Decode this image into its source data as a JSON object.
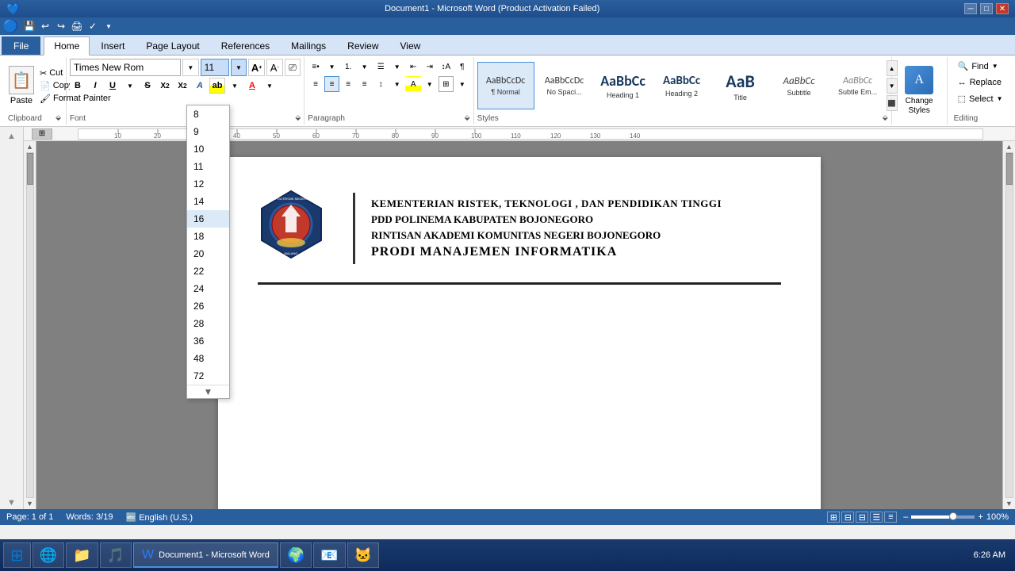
{
  "titleBar": {
    "text": "Document1 - Microsoft Word (Product Activation Failed)",
    "minimize": "─",
    "maximize": "□",
    "close": "✕"
  },
  "quickAccess": {
    "buttons": [
      "💾",
      "↩",
      "↪",
      "⬛",
      "✓"
    ]
  },
  "ribbonTabs": {
    "tabs": [
      "File",
      "Home",
      "Insert",
      "Page Layout",
      "References",
      "Mailings",
      "Review",
      "View"
    ]
  },
  "clipboard": {
    "paste": "Paste",
    "cut": "Cut",
    "copy": "Copy",
    "formatPainter": "Format Painter",
    "label": "Clipboard"
  },
  "font": {
    "name": "Times New Rom",
    "size": "11",
    "label": "Font"
  },
  "paragraph": {
    "label": "Paragraph"
  },
  "styles": {
    "items": [
      {
        "name": "Normal",
        "preview": "AaBbCcDc",
        "class": "normal-style-preview"
      },
      {
        "name": "No Spaci...",
        "preview": "AaBbCcDc",
        "class": "no-space-preview"
      },
      {
        "name": "Heading 1",
        "preview": "AaBbCc",
        "class": "h1-preview"
      },
      {
        "name": "Heading 2",
        "preview": "AaBbCc",
        "class": "h2-preview"
      },
      {
        "name": "Title",
        "preview": "AaB",
        "class": "title-preview"
      },
      {
        "name": "Subtitle",
        "preview": "AaBbCc",
        "class": "subtitle-preview"
      },
      {
        "name": "Subtle Em...",
        "preview": "AaBbCc",
        "class": "subtle-em-preview"
      }
    ],
    "label": "Styles"
  },
  "changeStyles": {
    "label": "Change\nStyles"
  },
  "editing": {
    "find": "Find",
    "replace": "Replace",
    "select": "Select",
    "label": "Editing"
  },
  "fontSizeDropdown": {
    "sizes": [
      "8",
      "9",
      "10",
      "11",
      "12",
      "14",
      "16",
      "18",
      "20",
      "22",
      "24",
      "26",
      "28",
      "36",
      "48",
      "72"
    ],
    "highlighted": "16"
  },
  "document": {
    "letterhead": {
      "line1": "KEMENTERIAN RISTEK, TEKNOLOGI , DAN PENDIDIKAN TINGGI",
      "line2": "PDD POLINEMA KABUPATEN BOJONEGORO",
      "line3": "RINTISAN AKADEMI KOMUNITAS NEGERI BOJONEGORO",
      "line4": "PRODI MANAJEMEN INFORMATIKA"
    }
  },
  "statusBar": {
    "page": "Page: 1 of 1",
    "words": "Words: 3/19",
    "language": "English (U.S.)",
    "zoom": "100%"
  },
  "taskbar": {
    "time": "6:26 AM",
    "appName": "Document1 - Microsoft Word"
  }
}
